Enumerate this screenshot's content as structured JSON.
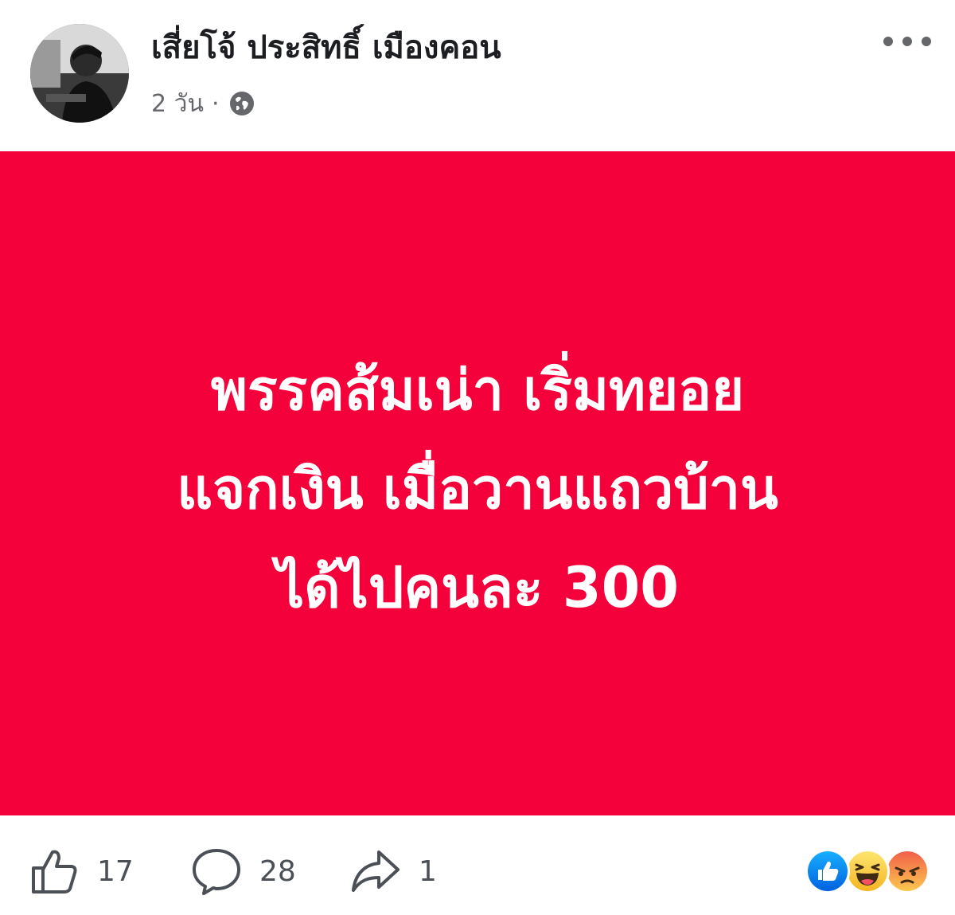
{
  "post": {
    "author_name": "เสี่ยโจ้ ประสิทธิ์ เมืองคอน",
    "time_ago": "2 วัน",
    "separator": "·",
    "privacy_icon": "globe-icon",
    "more_icon": "more-horizontal-icon"
  },
  "post_image": {
    "background_color": "#f4003b",
    "text_color": "#ffffff",
    "lines": [
      "พรรคส้มเน่า เริ่มทยอย",
      "แจกเงิน เมื่อวานแถวบ้าน",
      "ได้ไปคนละ 300"
    ]
  },
  "actions": {
    "like": {
      "icon": "thumbs-up-icon",
      "count": "17"
    },
    "comment": {
      "icon": "comment-icon",
      "count": "28"
    },
    "share": {
      "icon": "share-icon",
      "count": "1"
    }
  },
  "reactions": [
    "like-reaction-icon",
    "haha-reaction-icon",
    "angry-reaction-icon"
  ]
}
